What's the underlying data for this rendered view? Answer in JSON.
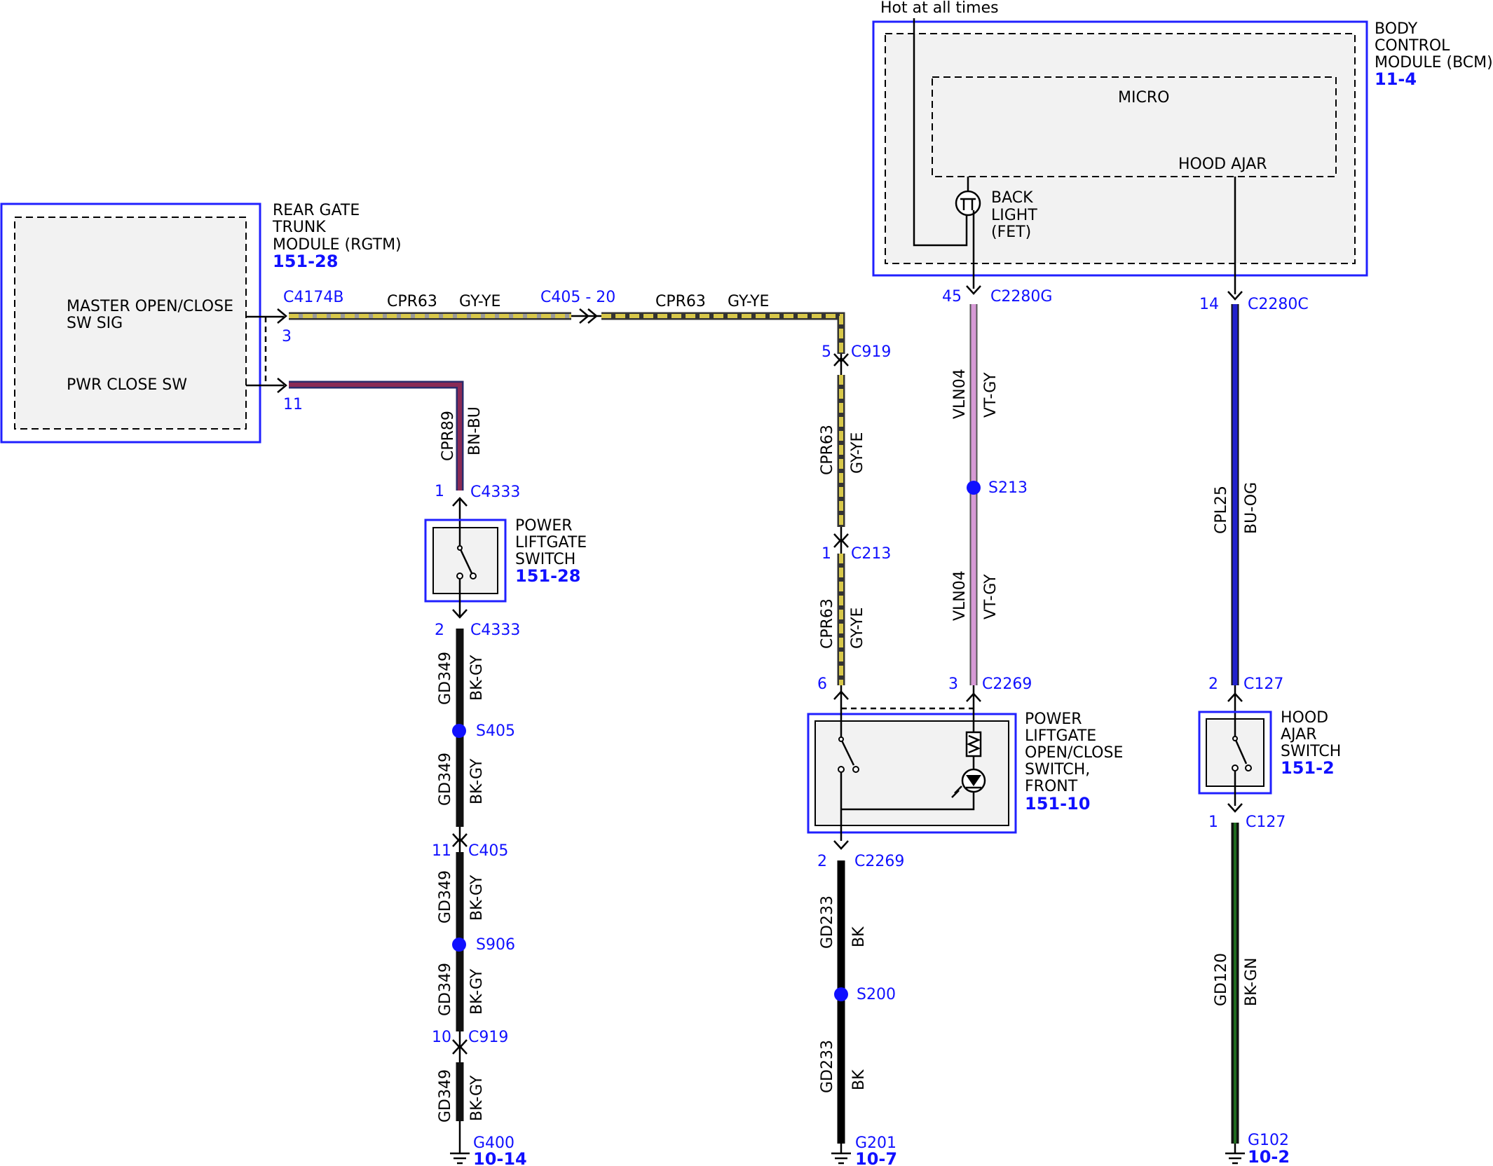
{
  "colors": {
    "module_border": "#2020ff",
    "connector_text": "#1010ff",
    "wire_gy_ye": "#d8c84a",
    "wire_bn_bu": "#8a2a55",
    "wire_bk_gy": "#111111",
    "wire_vt_gy": "#d79ad6",
    "wire_bu_og": "#2222cc",
    "wire_bk_gn": "#1f6b1f",
    "wire_bk": "#000000",
    "splice_dot": "#1010ff"
  },
  "top_label": "Hot at all times",
  "bcm": {
    "name_lines": [
      "BODY",
      "CONTROL",
      "MODULE (BCM)"
    ],
    "ref": "11-4",
    "micro": "MICRO",
    "hood_ajar": "HOOD AJAR",
    "back_light_lines": [
      "BACK",
      "LIGHT",
      "(FET)"
    ]
  },
  "rgtm": {
    "name_lines": [
      "REAR GATE",
      "TRUNK",
      "MODULE (RGTM)"
    ],
    "ref": "151-28",
    "master_lines": [
      "MASTER OPEN/CLOSE",
      "SW SIG"
    ],
    "pwr_close": "PWR CLOSE SW"
  },
  "horizontal": {
    "pin3": "3",
    "c4174b": "C4174B",
    "cpr63_a": "CPR63",
    "gyye_a": "GY-YE",
    "c405_20": "C405 - 20",
    "cpr63_b": "CPR63",
    "gyye_b": "GY-YE",
    "pin11": "11"
  },
  "col1": {
    "cpr89": "CPR89",
    "bnbu": "BN-BU",
    "pin1": "1",
    "c4333_top": "C4333",
    "switch_lines": [
      "POWER",
      "LIFTGATE",
      "SWITCH"
    ],
    "switch_ref": "151-28",
    "pin2": "2",
    "c4333_bot": "C4333",
    "gd349": "GD349",
    "bkgy": "BK-GY",
    "s405": "S405",
    "pin11": "11",
    "c405": "C405",
    "s906": "S906",
    "pin10": "10",
    "c919": "C919",
    "g400": "G400",
    "g400_ref": "10-14"
  },
  "col2": {
    "pin5": "5",
    "c919": "C919",
    "cpr63": "CPR63",
    "gyye": "GY-YE",
    "pin1": "1",
    "c213": "C213",
    "pin6": "6",
    "switch_lines": [
      "POWER",
      "LIFTGATE",
      "OPEN/CLOSE",
      "SWITCH,",
      "FRONT"
    ],
    "switch_ref": "151-10",
    "pin2": "2",
    "c2269": "C2269",
    "gd233": "GD233",
    "bk": "BK",
    "s200": "S200",
    "g201": "G201",
    "g201_ref": "10-7"
  },
  "col3": {
    "pin45": "45",
    "c2280g": "C2280G",
    "vln04": "VLN04",
    "vtgy": "VT-GY",
    "s213": "S213",
    "pin3": "3",
    "c2269": "C2269"
  },
  "col4": {
    "pin14": "14",
    "c2280c": "C2280C",
    "cpl25": "CPL25",
    "buog": "BU-OG",
    "pin2": "2",
    "c127_top": "C127",
    "switch_lines": [
      "HOOD",
      "AJAR",
      "SWITCH"
    ],
    "switch_ref": "151-2",
    "pin1": "1",
    "c127_bot": "C127",
    "gd120": "GD120",
    "bkgn": "BK-GN",
    "g102": "G102",
    "g102_ref": "10-2"
  }
}
